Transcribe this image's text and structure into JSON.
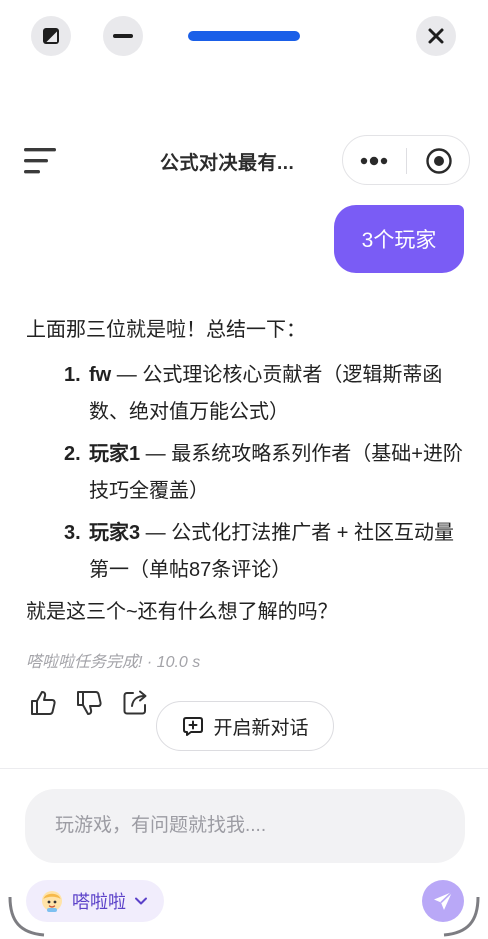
{
  "window": {
    "icons": [
      "collapse-icon",
      "minimize-icon",
      "close-icon"
    ],
    "accent": "#1a5fe8"
  },
  "header": {
    "title": "公式对决最有...",
    "icons": [
      "menu-icon",
      "more-dots-icon",
      "target-icon"
    ]
  },
  "chat": {
    "user_message": "3个玩家",
    "user_bubble_color": "#7a5cf5",
    "answer": {
      "intro": "上面那三位就是啦！总结一下：",
      "items": [
        {
          "num": "1.",
          "name": "fw",
          "text": " — 公式理论核心贡献者（逻辑斯蒂函数、绝对值万能公式）"
        },
        {
          "num": "2.",
          "name": "玩家1",
          "text": " — 最系统攻略系列作者（基础+进阶技巧全覆盖）"
        },
        {
          "num": "3.",
          "name": "玩家3",
          "text": " — 公式化打法推广者 + 社区互动量第一（单帖87条评论）"
        }
      ],
      "outro": "就是这三个~还有什么想了解的吗？"
    },
    "status": "嗒啦啦任务完成! · 10.0 s",
    "actions": [
      "thumbs-up-icon",
      "thumbs-down-icon",
      "share-icon"
    ],
    "new_chat_label": "开启新对话"
  },
  "composer": {
    "placeholder": "玩游戏，有问题就找我....",
    "agent_name": "嗒啦啦",
    "send_color": "#b9a8f7"
  }
}
